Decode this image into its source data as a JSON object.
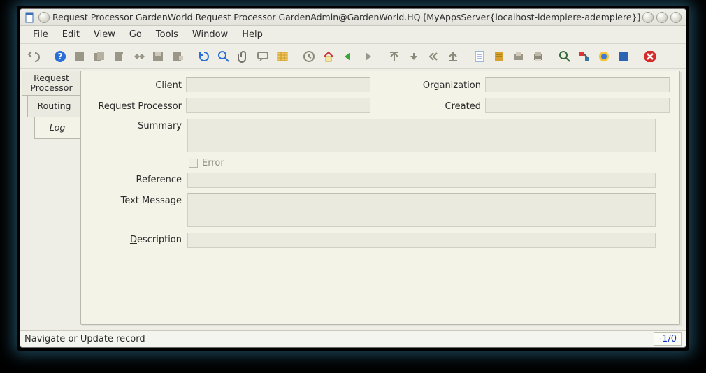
{
  "window": {
    "title": "Request Processor  GardenWorld Request Processor  GardenAdmin@GardenWorld.HQ [MyAppsServer{localhost-idempiere-adempiere}]"
  },
  "menu": {
    "file": "File",
    "edit": "Edit",
    "view": "View",
    "go": "Go",
    "tools": "Tools",
    "window": "Window",
    "help": "Help"
  },
  "toolbar_icons": [
    "undo-icon",
    "help-icon",
    "new-icon",
    "copy-icon",
    "delete-icon",
    "tool-icon",
    "save-icon",
    "save-new-icon",
    "refresh-icon",
    "find-icon",
    "attachment-icon",
    "chat-icon",
    "grid-icon",
    "history-icon",
    "home-icon",
    "back-icon",
    "forward-icon",
    "first-icon",
    "previous-icon",
    "next-icon",
    "last-icon",
    "report-icon",
    "archive-icon",
    "print-preview-icon",
    "print-icon",
    "zoom-icon",
    "process-icon",
    "workflow-icon",
    "product-icon",
    "close-icon"
  ],
  "tabs": [
    {
      "label_a": "Request",
      "label_b": "Processor",
      "active": false
    },
    {
      "label_a": "Routing",
      "label_b": "",
      "active": false
    },
    {
      "label_a": "Log",
      "label_b": "",
      "active": true
    }
  ],
  "form": {
    "client_label": "Client",
    "organization_label": "Organization",
    "request_processor_label": "Request Processor",
    "created_label": "Created",
    "summary_label": "Summary",
    "error_label": "Error",
    "reference_label": "Reference",
    "text_message_label": "Text Message",
    "description_label": "Description",
    "values": {
      "client": "",
      "organization": "",
      "request_processor": "",
      "created": "",
      "summary": "",
      "error": false,
      "reference": "",
      "text_message": "",
      "description": ""
    }
  },
  "status": {
    "message": "Navigate or Update record",
    "counter": "-1/0"
  }
}
